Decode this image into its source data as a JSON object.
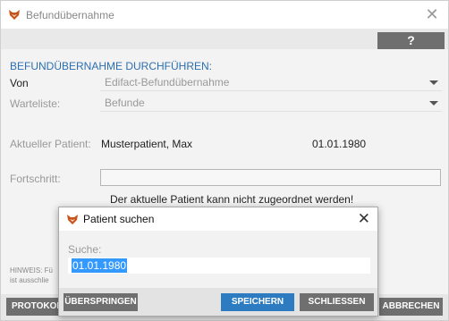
{
  "window": {
    "title": "Befundübernahme",
    "help_label": "?",
    "section_title": "BEFUNDÜBERNAHME DURCHFÜHREN:",
    "von_label": "Von",
    "von_value": "Edifact-Befundübernahme",
    "warteliste_label": "Warteliste:",
    "warteliste_value": "Befunde",
    "patient_label": "Aktueller Patient:",
    "patient_name": "Musterpatient, Max",
    "patient_date": "01.01.1980",
    "fortschritt_label": "Fortschritt:",
    "progress_value": 0,
    "warning_text": "Der aktuelle Patient kann nicht zugeordnet werden!",
    "hint_line1": "HINWEIS: Fü",
    "hint_line2": "ist ausschlie",
    "protokoll_label": "PROTOKOL",
    "abbrechen_label": "ABBRECHEN"
  },
  "dialog": {
    "title": "Patient suchen",
    "search_label": "Suche:",
    "search_value": "01.01.1980",
    "skip_label": "ÜBERSPRINGEN",
    "save_label": "SPEICHERN",
    "close_label": "SCHLIESSEN"
  },
  "icons": {
    "app": "fox-logo-icon",
    "close": "close-icon",
    "dropdown": "chevron-down-icon"
  },
  "colors": {
    "accent": "#2c6fae",
    "primary_button": "#2d7cc1",
    "secondary_button": "#6f6f6f",
    "selection": "#3399ff"
  }
}
